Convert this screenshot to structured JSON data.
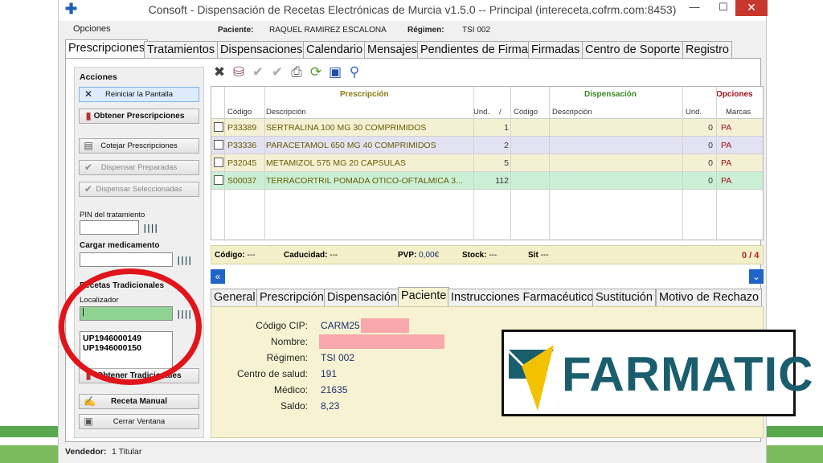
{
  "window": {
    "title": "Consoft - Dispensación de Recetas Electrónicas de Murcia v1.5.0  -- Principal (intereceta.cofrm.com:8453)",
    "min": "—",
    "max": "☐",
    "close": "✕"
  },
  "menu": {
    "opciones": "Opciones"
  },
  "patient": {
    "label": "Paciente:",
    "name": "RAQUEL RAMIREZ ESCALONA",
    "regimen_label": "Régimen:",
    "regimen": "TSI 002"
  },
  "tabs": [
    "Prescripciones",
    "Tratamientos",
    "Dispensaciones",
    "Calendario",
    "Mensajes",
    "Pendientes de Firma",
    "Firmadas",
    "Centro de Soporte",
    "Registro"
  ],
  "left": {
    "acciones": "Acciones",
    "reiniciar": "Reiniciar la Pantalla",
    "obtener": "Obtener Prescripciones",
    "cotejar": "Cotejar Prescripciones",
    "disp_prep": "Dispensar Preparadas",
    "disp_sel": "Dispensar Seleccionadas",
    "pin": "PIN del tratamiento",
    "cargar": "Cargar medicamento",
    "recetas": "Recetas Tradicionales",
    "localizador": "Localizador",
    "localizador_value": "|",
    "recetas_list": [
      "UP1946000149",
      "UP1946000150"
    ],
    "obtener_trad": "Obtener Tradicionales",
    "receta_manual": "Receta Manual",
    "cerrar": "Cerrar Ventana"
  },
  "grid": {
    "groups": {
      "prescripcion": "Prescripción",
      "dispensacion": "Dispensación",
      "opciones": "Opciones"
    },
    "cols": {
      "codigo": "Código",
      "descripcion": "Descripción",
      "und": "Und.",
      "sort": "/",
      "d_codigo": "Código",
      "d_descripcion": "Descripción",
      "d_und": "Und.",
      "marcas": "Marcas"
    },
    "rows": [
      {
        "codigo": "P33389",
        "descripcion": "SERTRALINA 100 MG 30 COMPRIMIDOS",
        "und": "1",
        "d_und": "0",
        "marca": "PA",
        "bg": "#f4f0d4"
      },
      {
        "codigo": "P33336",
        "descripcion": "PARACETAMOL 650 MG 40 COMPRIMIDOS",
        "und": "2",
        "d_und": "0",
        "marca": "PA",
        "bg": "#e3e2f2"
      },
      {
        "codigo": "P32045",
        "descripcion": "METAMIZOL 575 MG 20 CAPSULAS",
        "und": "5",
        "d_und": "0",
        "marca": "PA",
        "bg": "#f4f0d4"
      },
      {
        "codigo": "S00037",
        "descripcion": "TERRACORTRIL POMADA OTICO-OFTALMICA 3...",
        "und": "112",
        "d_und": "0",
        "marca": "PA",
        "bg": "#c9f0d5"
      }
    ]
  },
  "status": {
    "codigo_l": "Código:",
    "codigo": "---",
    "caducidad_l": "Caducidad:",
    "caducidad": "---",
    "pvp_l": "PVP:",
    "pvp": "0,00€",
    "stock_l": "Stock:",
    "stock": "---",
    "sit_l": "Sit",
    "sit": "---",
    "count": "0 / 4"
  },
  "subtabs": [
    "General",
    "Prescripción",
    "Dispensación",
    "Paciente",
    "Instrucciones Farmacéutico",
    "Sustitución",
    "Motivo de Rechazo"
  ],
  "paciente": {
    "cip_l": "Código CIP:",
    "cip": "CARM25",
    "nombre_l": "Nombre:",
    "regimen_l": "Régimen:",
    "regimen": "TSI 002",
    "centro_l": "Centro de salud:",
    "centro": "191",
    "medico_l": "Médico:",
    "medico": "21635",
    "saldo_l": "Saldo:",
    "saldo": "8,23"
  },
  "footer": {
    "vendedor_l": "Vendedor:",
    "vendedor": "1 Titular"
  },
  "logo": {
    "text": "FARMATIC",
    "color": "#1a5e6e",
    "accent": "#f2c200"
  }
}
